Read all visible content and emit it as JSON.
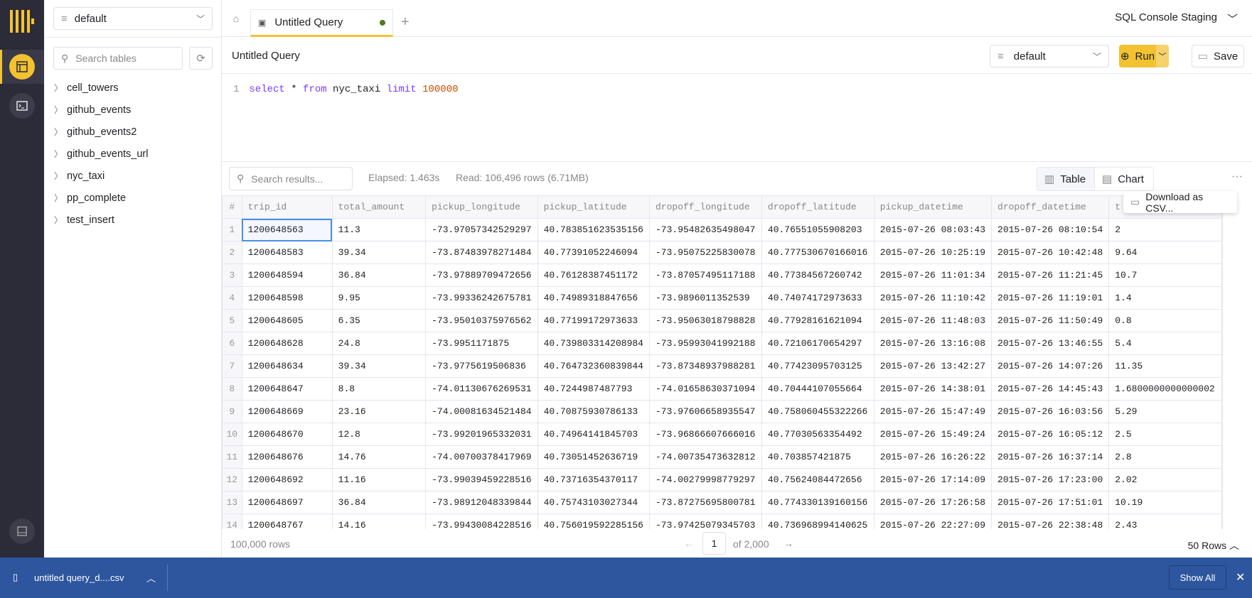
{
  "app": {
    "database": "default",
    "org": "SQL Console Staging"
  },
  "sidebar": {
    "search_placeholder": "Search tables",
    "tables": [
      "cell_towers",
      "github_events",
      "github_events2",
      "github_events_url",
      "nyc_taxi",
      "pp_complete",
      "test_insert"
    ]
  },
  "tabs": [
    {
      "label": "Untitled Query",
      "unsaved": true
    }
  ],
  "query": {
    "title": "Untitled Query",
    "database": "default",
    "run_label": "Run",
    "save_label": "Save",
    "line": "1",
    "sql": {
      "k1": "select",
      "t1": " * ",
      "k2": "from",
      "t2": " nyc_taxi ",
      "k3": "limit",
      "n": " 100000"
    }
  },
  "results": {
    "search_placeholder": "Search results...",
    "elapsed": "Elapsed: 1.463s",
    "read": "Read: 106,496 rows (6.71MB)",
    "view_table": "Table",
    "view_chart": "Chart",
    "menu_item": "Download as CSV...",
    "columns": [
      "#",
      "trip_id",
      "total_amount",
      "pickup_longitude",
      "pickup_latitude",
      "dropoff_longitude",
      "dropoff_latitude",
      "pickup_datetime",
      "dropoff_datetime",
      "t"
    ],
    "rows": [
      [
        "1",
        "1200648563",
        "11.3",
        "-73.97057342529297",
        "40.783851623535156",
        "-73.95482635498047",
        "40.76551055908203",
        "2015-07-26 08:03:43",
        "2015-07-26 08:10:54",
        "2"
      ],
      [
        "2",
        "1200648583",
        "39.34",
        "-73.87483978271484",
        "40.77391052246094",
        "-73.95075225830078",
        "40.777530670166016",
        "2015-07-26 10:25:19",
        "2015-07-26 10:42:48",
        "9.64"
      ],
      [
        "3",
        "1200648594",
        "36.84",
        "-73.97889709472656",
        "40.76128387451172",
        "-73.87057495117188",
        "40.77384567260742",
        "2015-07-26 11:01:34",
        "2015-07-26 11:21:45",
        "10.7"
      ],
      [
        "4",
        "1200648598",
        "9.95",
        "-73.99336242675781",
        "40.74989318847656",
        "-73.9896011352539",
        "40.74074172973633",
        "2015-07-26 11:10:42",
        "2015-07-26 11:19:01",
        "1.4"
      ],
      [
        "5",
        "1200648605",
        "6.35",
        "-73.95010375976562",
        "40.77199172973633",
        "-73.95063018798828",
        "40.77928161621094",
        "2015-07-26 11:48:03",
        "2015-07-26 11:50:49",
        "0.8"
      ],
      [
        "6",
        "1200648628",
        "24.8",
        "-73.9951171875",
        "40.739803314208984",
        "-73.95993041992188",
        "40.72106170654297",
        "2015-07-26 13:16:08",
        "2015-07-26 13:46:55",
        "5.4"
      ],
      [
        "7",
        "1200648634",
        "39.34",
        "-73.9775619506836",
        "40.764732360839844",
        "-73.87348937988281",
        "40.77423095703125",
        "2015-07-26 13:42:27",
        "2015-07-26 14:07:26",
        "11.35"
      ],
      [
        "8",
        "1200648647",
        "8.8",
        "-74.01130676269531",
        "40.7244987487793",
        "-74.01658630371094",
        "40.70444107055664",
        "2015-07-26 14:38:01",
        "2015-07-26 14:45:43",
        "1.6800000000000002"
      ],
      [
        "9",
        "1200648669",
        "23.16",
        "-74.00081634521484",
        "40.70875930786133",
        "-73.97606658935547",
        "40.758060455322266",
        "2015-07-26 15:47:49",
        "2015-07-26 16:03:56",
        "5.29"
      ],
      [
        "10",
        "1200648670",
        "12.8",
        "-73.99201965332031",
        "40.74964141845703",
        "-73.96866607666016",
        "40.77030563354492",
        "2015-07-26 15:49:24",
        "2015-07-26 16:05:12",
        "2.5"
      ],
      [
        "11",
        "1200648676",
        "14.76",
        "-74.00700378417969",
        "40.73051452636719",
        "-74.00735473632812",
        "40.703857421875",
        "2015-07-26 16:26:22",
        "2015-07-26 16:37:14",
        "2.8"
      ],
      [
        "12",
        "1200648692",
        "11.16",
        "-73.99039459228516",
        "40.73716354370117",
        "-74.00279998779297",
        "40.75624084472656",
        "2015-07-26 17:14:09",
        "2015-07-26 17:23:00",
        "2.02"
      ],
      [
        "13",
        "1200648697",
        "36.84",
        "-73.98912048339844",
        "40.75743103027344",
        "-73.87275695800781",
        "40.774330139160156",
        "2015-07-26 17:26:58",
        "2015-07-26 17:51:01",
        "10.19"
      ],
      [
        "14",
        "1200648767",
        "14.16",
        "-73.99430084228516",
        "40.756019592285156",
        "-73.97425079345703",
        "40.736968994140625",
        "2015-07-26 22:27:09",
        "2015-07-26 22:38:48",
        "2.43"
      ]
    ],
    "row_count": "100,000 rows",
    "page": "1",
    "page_of": "of 2,000",
    "page_size": "50 Rows"
  },
  "download_bar": {
    "file": "untitled query_d....csv",
    "show_all": "Show All"
  },
  "colors": {
    "accent": "#f2c231",
    "rail": "#2c2b38",
    "download_bar": "#2d569e"
  }
}
